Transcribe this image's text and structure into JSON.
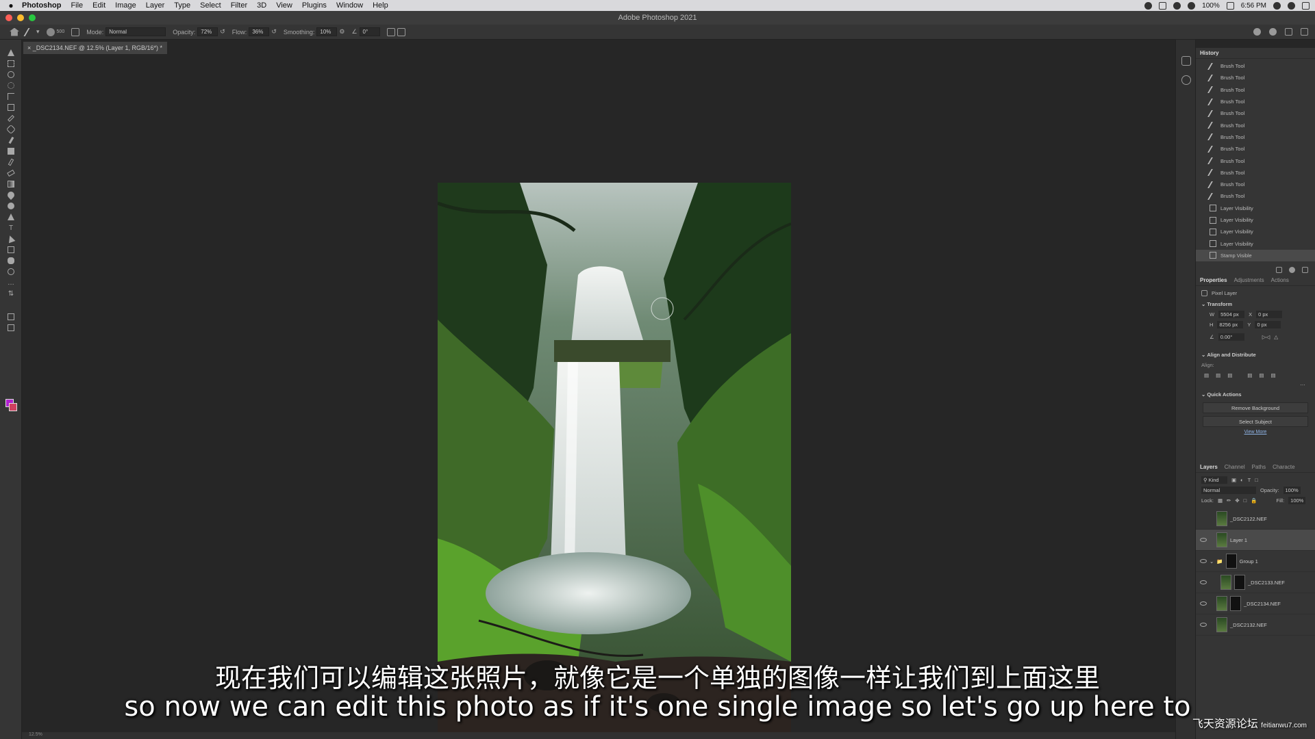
{
  "menubar": {
    "app_name": "Photoshop",
    "items": [
      "File",
      "Edit",
      "Image",
      "Layer",
      "Type",
      "Select",
      "Filter",
      "3D",
      "View",
      "Plugins",
      "Window",
      "Help"
    ],
    "battery": "100%",
    "time": "6:56 PM"
  },
  "window": {
    "title": "Adobe Photoshop 2021"
  },
  "options_bar": {
    "brush_size": "500",
    "mode_label": "Mode:",
    "mode_value": "Normal",
    "opacity_label": "Opacity:",
    "opacity_value": "72%",
    "flow_label": "Flow:",
    "flow_value": "36%",
    "smoothing_label": "Smoothing:",
    "smoothing_value": "10%",
    "angle_value": "0°"
  },
  "document": {
    "tab_label": "_DSC2134.NEF @ 12.5% (Layer 1, RGB/16*) *"
  },
  "colors": {
    "foreground": "#b020d0",
    "background": "#d04060"
  },
  "history": {
    "title": "History",
    "items": [
      {
        "label": "Brush Tool",
        "icon": "brush-icon"
      },
      {
        "label": "Brush Tool",
        "icon": "brush-icon"
      },
      {
        "label": "Brush Tool",
        "icon": "brush-icon"
      },
      {
        "label": "Brush Tool",
        "icon": "brush-icon"
      },
      {
        "label": "Brush Tool",
        "icon": "brush-icon"
      },
      {
        "label": "Brush Tool",
        "icon": "brush-icon"
      },
      {
        "label": "Brush Tool",
        "icon": "brush-icon"
      },
      {
        "label": "Brush Tool",
        "icon": "brush-icon"
      },
      {
        "label": "Brush Tool",
        "icon": "brush-icon"
      },
      {
        "label": "Brush Tool",
        "icon": "brush-icon"
      },
      {
        "label": "Brush Tool",
        "icon": "brush-icon"
      },
      {
        "label": "Brush Tool",
        "icon": "brush-icon"
      },
      {
        "label": "Layer Visibility",
        "icon": "document-icon"
      },
      {
        "label": "Layer Visibility",
        "icon": "document-icon"
      },
      {
        "label": "Layer Visibility",
        "icon": "document-icon"
      },
      {
        "label": "Layer Visibility",
        "icon": "document-icon"
      },
      {
        "label": "Stamp Visible",
        "icon": "document-icon"
      }
    ]
  },
  "properties": {
    "tabs": [
      "Properties",
      "Adjustments",
      "Actions"
    ],
    "layer_type": "Pixel Layer",
    "transform_label": "Transform",
    "w_label": "W",
    "w_value": "5504 px",
    "h_label": "H",
    "h_value": "8256 px",
    "x_label": "X",
    "x_value": "0 px",
    "y_label": "Y",
    "y_value": "0 px",
    "angle_value": "0.00°",
    "align_label": "Align and Distribute",
    "align_sub": "Align:",
    "quick_actions_label": "Quick Actions",
    "remove_bg": "Remove Background",
    "select_subject": "Select Subject",
    "view_more": "View More"
  },
  "layers": {
    "tabs": [
      "Layers",
      "Channel",
      "Paths",
      "Characte"
    ],
    "filter_label": "Kind",
    "blend_mode": "Normal",
    "opacity_label": "Opacity:",
    "opacity_value": "100%",
    "lock_label": "Lock:",
    "fill_label": "Fill:",
    "fill_value": "100%",
    "items": [
      {
        "name": "_DSC2122.NEF",
        "visible": false,
        "selected": false,
        "mask": false
      },
      {
        "name": "Layer 1",
        "visible": true,
        "selected": true,
        "mask": false
      },
      {
        "name": "Group 1",
        "visible": true,
        "selected": false,
        "mask": true
      },
      {
        "name": "_DSC2133.NEF",
        "visible": true,
        "selected": false,
        "mask": true
      },
      {
        "name": "_DSC2134.NEF",
        "visible": true,
        "selected": false,
        "mask": true
      },
      {
        "name": "_DSC2132.NEF",
        "visible": true,
        "selected": false,
        "mask": false
      }
    ]
  },
  "status": {
    "zoom": "12.5%"
  },
  "subtitles": {
    "chinese": "现在我们可以编辑这张照片，就像它是一个单独的图像一样让我们到上面这里",
    "english": "so now we can edit this photo as if it's one single image so let's go up here to"
  },
  "watermark": {
    "text": "飞天资源论坛",
    "url": "feitianwu7.com"
  }
}
